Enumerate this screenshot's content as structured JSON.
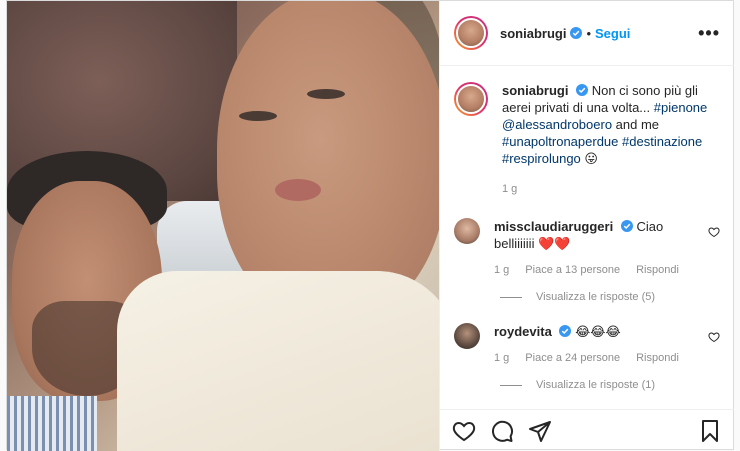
{
  "header": {
    "username": "soniabrugi",
    "separator": "•",
    "follow_label": "Segui",
    "more_label": "•••"
  },
  "caption": {
    "username": "soniabrugi",
    "text": "Non ci sono più gli aerei privati di una volta...",
    "hashtag_1": "#pienone",
    "mention": "@alessandroboero",
    "and_me": "and me",
    "hashtag_2": "#unapoltronaperdue",
    "hashtag_3": "#destinazione",
    "hashtag_4": "#respirolungo",
    "emoji": "😛",
    "time": "1 g"
  },
  "comments": [
    {
      "username": "missclaudiaruggeri",
      "text": "Ciao belliiiiiii",
      "emoji": "❤️❤️",
      "time": "1 g",
      "likes": "Piace a 13 persone",
      "reply_label": "Rispondi",
      "view_replies": "Visualizza le risposte (5)"
    },
    {
      "username": "roydevita",
      "text": "",
      "emoji": "😂😂😂",
      "time": "1 g",
      "likes": "Piace a 24 persone",
      "reply_label": "Rispondi",
      "view_replies": "Visualizza le risposte (1)"
    }
  ],
  "icons": {
    "verified": "verified-badge-icon",
    "like": "heart-icon",
    "comment": "comment-icon",
    "share": "share-icon",
    "save": "bookmark-icon"
  },
  "colors": {
    "link_blue": "#0095f6",
    "hashtag": "#00376b",
    "muted": "#8e8e8e",
    "verified": "#3897f0"
  }
}
